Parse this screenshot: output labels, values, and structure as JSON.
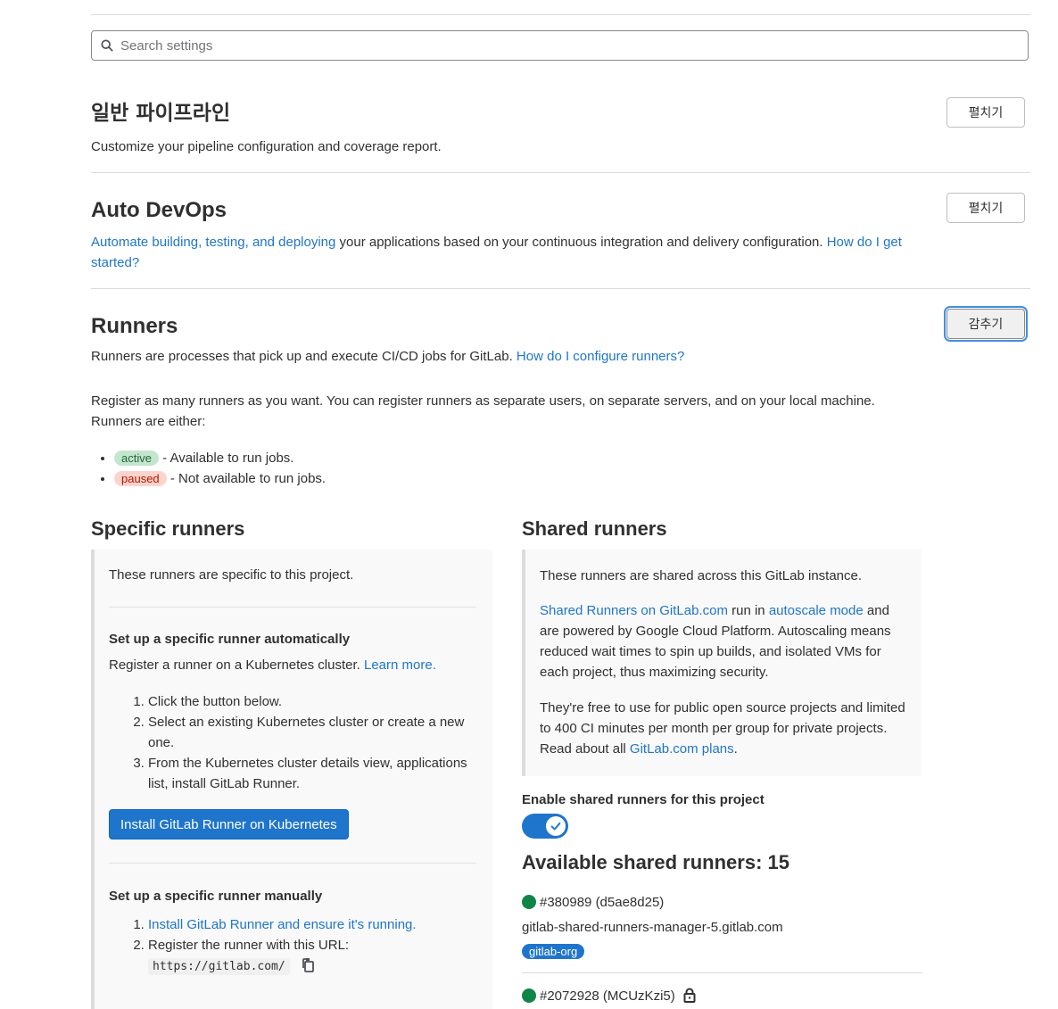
{
  "search": {
    "placeholder": "Search settings"
  },
  "sections": {
    "general": {
      "title": "일반 파이프라인",
      "description": "Customize your pipeline configuration and coverage report.",
      "button": "펼치기"
    },
    "autodevops": {
      "title": "Auto DevOps",
      "link_text": "Automate building, testing, and deploying",
      "description": " your applications based on your continuous integration and delivery configuration. ",
      "help_link": "How do I get started?",
      "button": "펼치기"
    },
    "runners": {
      "title": "Runners",
      "description": "Runners are processes that pick up and execute CI/CD jobs for GitLab. ",
      "help_link": "How do I configure runners?",
      "button": "감추기",
      "register_text": "Register as many runners as you want. You can register runners as separate users, on separate servers, and on your local machine. Runners are either:",
      "states": [
        {
          "badge": "active",
          "text": " - Available to run jobs."
        },
        {
          "badge": "paused",
          "text": " - Not available to run jobs."
        }
      ]
    }
  },
  "specific": {
    "title": "Specific runners",
    "intro": "These runners are specific to this project.",
    "auto": {
      "heading": "Set up a specific runner automatically",
      "text": "Register a runner on a Kubernetes cluster. ",
      "learn_more": "Learn more.",
      "steps": [
        "Click the button below.",
        "Select an existing Kubernetes cluster or create a new one.",
        "From the Kubernetes cluster details view, applications list, install GitLab Runner."
      ],
      "button": "Install GitLab Runner on Kubernetes"
    },
    "manual": {
      "heading": "Set up a specific runner manually",
      "step1_link": "Install GitLab Runner and ensure it's running.",
      "step2": "Register the runner with this URL:",
      "url": "https://gitlab.com/"
    }
  },
  "shared": {
    "title": "Shared runners",
    "intro": "These runners are shared across this GitLab instance.",
    "p1_link1": "Shared Runners on GitLab.com",
    "p1_mid": " run in ",
    "p1_link2": "autoscale mode",
    "p1_rest": " and are powered by Google Cloud Platform. Autoscaling means reduced wait times to spin up builds, and isolated VMs for each project, thus maximizing security.",
    "p2_text": "They're free to use for public open source projects and limited to 400 CI minutes per month per group for private projects. Read about all ",
    "p2_link": "GitLab.com plans",
    "p2_end": ".",
    "toggle_label": "Enable shared runners for this project",
    "toggle_on": true,
    "available": "Available shared runners: 15",
    "runners": [
      {
        "id": "#380989 (d5ae8d25)",
        "host": "gitlab-shared-runners-manager-5.gitlab.com",
        "tag": "gitlab-org",
        "status_color": "#108548"
      },
      {
        "id": "#2072928 (MCUzKzi5)",
        "status_color": "#108548"
      }
    ]
  }
}
